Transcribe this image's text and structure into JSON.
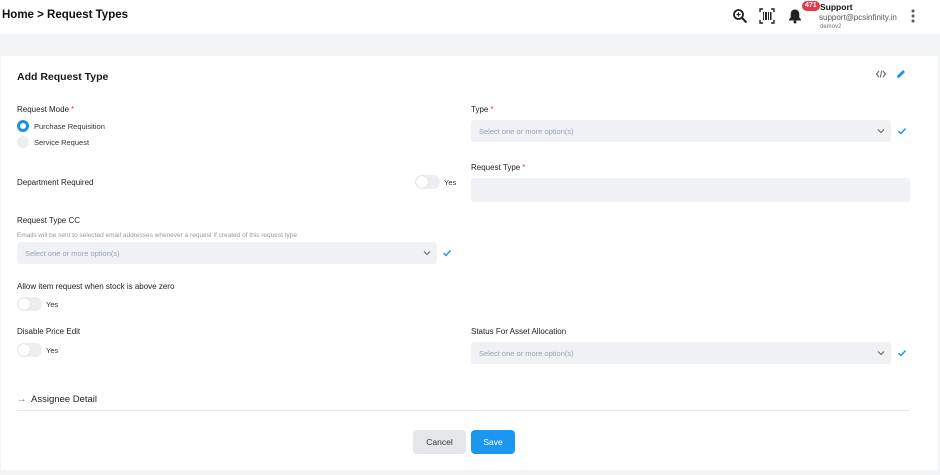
{
  "header": {
    "breadcrumb": "Home > Request Types",
    "notification_count": "471",
    "user_name": "Support",
    "user_email": "support@pcsinfinity.in",
    "user_sub": "demov2",
    "icons": [
      "zoom-icon",
      "barcode-icon",
      "bell-icon",
      "kebab-menu-icon"
    ]
  },
  "form": {
    "title": "Add Request Type",
    "request_mode": {
      "label": "Request Mode",
      "required_mark": "*",
      "options": [
        "Purchase Requisition",
        "Service Request"
      ],
      "selected": "Purchase Requisition"
    },
    "type": {
      "label": "Type",
      "required_mark": "*",
      "placeholder": "Select one or more option(s)"
    },
    "department_required": {
      "label": "Department Required",
      "toggle_label": "Yes"
    },
    "request_type": {
      "label": "Request Type",
      "required_mark": "*",
      "value": ""
    },
    "request_type_cc": {
      "label": "Request Type CC",
      "help": "Emails will be sent to selected email addresses whenever a request if created of this request type",
      "placeholder": "Select one or more option(s)"
    },
    "allow_item": {
      "label": "Allow item request when stock is above zero",
      "toggle_label": "Yes"
    },
    "disable_price": {
      "label": "Disable Price Edit",
      "toggle_label": "Yes"
    },
    "asset_status": {
      "label": "Status For Asset Allocation",
      "placeholder": "Select one or more option(s)"
    },
    "assignee_detail": "Assignee Detail",
    "cancel_label": "Cancel",
    "save_label": "Save"
  },
  "colors": {
    "accent": "#1891e8",
    "required": "#e53935",
    "badge": "#e8364a"
  }
}
